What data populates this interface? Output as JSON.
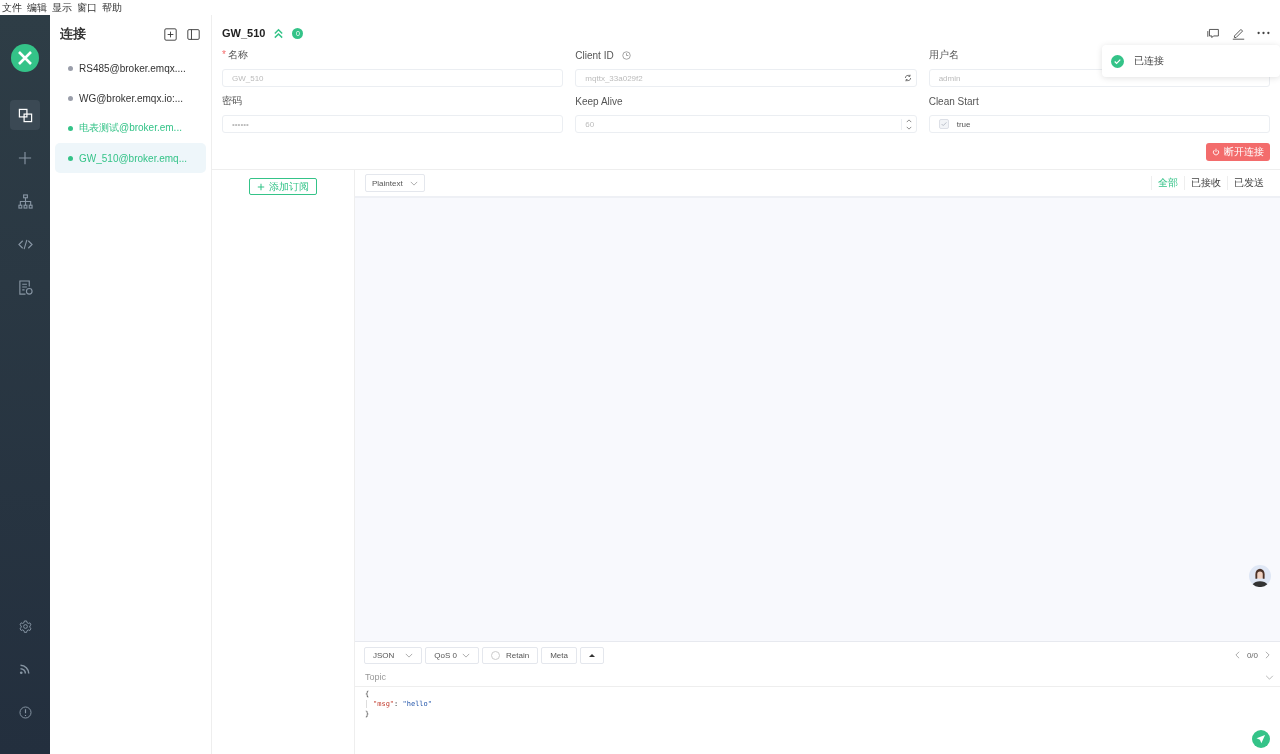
{
  "menu_bar": [
    "文件",
    "编辑",
    "显示",
    "窗口",
    "帮助"
  ],
  "nav": {
    "items": [
      {
        "selected": true
      },
      {
        "selected": false
      },
      {
        "selected": false
      },
      {
        "selected": false
      },
      {
        "selected": false
      }
    ]
  },
  "connections": {
    "title": "连接",
    "items": [
      {
        "name": "RS485@broker.emqx....",
        "online": false,
        "selected": false
      },
      {
        "name": "WG@broker.emqx.io:...",
        "online": false,
        "selected": false
      },
      {
        "name": "电表测试@broker.em...",
        "online": true,
        "selected": false
      },
      {
        "name": "GW_510@broker.emq...",
        "online": true,
        "selected": true
      }
    ]
  },
  "header": {
    "title": "GW_510",
    "badge": "0"
  },
  "form": {
    "fields": [
      {
        "kind": "text",
        "label": "名称",
        "required_mark": "*",
        "value": "GW_510"
      },
      {
        "kind": "clientid",
        "label": "Client ID",
        "value": "mqttx_33a029f2"
      },
      {
        "kind": "text",
        "label": "用户名",
        "value": "admin"
      },
      {
        "kind": "text",
        "label": "密码",
        "value": "••••••"
      },
      {
        "kind": "number",
        "label": "Keep Alive",
        "value": "60"
      },
      {
        "kind": "checkbox",
        "label": "Clean Start",
        "value": "true",
        "checked": true
      }
    ],
    "disconnect_button": "断开连接"
  },
  "toast": {
    "text": "已连接"
  },
  "subscriptions": {
    "add_button": "添加订阅"
  },
  "messages": {
    "format": "Plaintext",
    "filters": [
      {
        "label": "全部",
        "selected": true
      },
      {
        "label": "已接收",
        "selected": false
      },
      {
        "label": "已发送",
        "selected": false
      }
    ]
  },
  "publish": {
    "format": "JSON",
    "qos": "QoS 0",
    "retain": {
      "label": "Retain",
      "checked": false
    },
    "meta": "Meta",
    "pager": "0/0",
    "topic_placeholder": "Topic",
    "payload": [
      {
        "kind": "brace",
        "text": "{"
      },
      {
        "kind": "pair",
        "key": "\"msg\"",
        "sep": ": ",
        "value": "\"hello\""
      },
      {
        "kind": "brace",
        "text": "}"
      }
    ]
  }
}
